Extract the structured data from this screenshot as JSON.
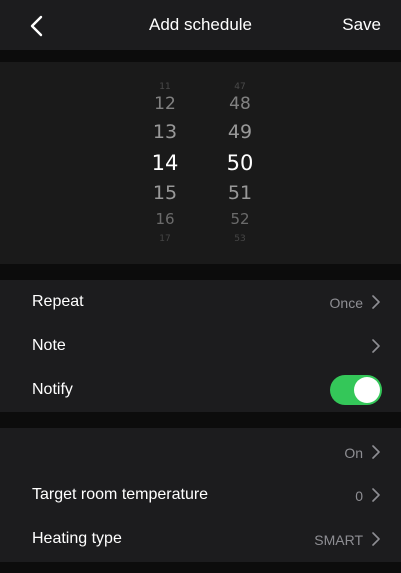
{
  "header": {
    "title": "Add schedule",
    "save_label": "Save"
  },
  "time_picker": {
    "hours": [
      "11",
      "12",
      "13",
      "14",
      "15",
      "16",
      "17"
    ],
    "minutes": [
      "47",
      "48",
      "49",
      "50",
      "51",
      "52",
      "53"
    ],
    "selected_hour": "14",
    "selected_minute": "50"
  },
  "settings": {
    "repeat": {
      "label": "Repeat",
      "value": "Once"
    },
    "note": {
      "label": "Note",
      "value": ""
    },
    "notify": {
      "label": "Notify",
      "enabled": true
    }
  },
  "heating": {
    "state": {
      "label": "",
      "value": "On"
    },
    "target_temp": {
      "label": "Target room temperature",
      "value": "0"
    },
    "heating_type": {
      "label": "Heating type",
      "value": "SMART"
    }
  },
  "colors": {
    "toggle_on": "#34c759",
    "secondary_text": "#8e8e93",
    "row_bg": "#1c1c1e",
    "app_bg": "#0c0c0c"
  },
  "icons": {
    "back": "chevron-left-icon",
    "row_arrow": "chevron-right-icon"
  }
}
